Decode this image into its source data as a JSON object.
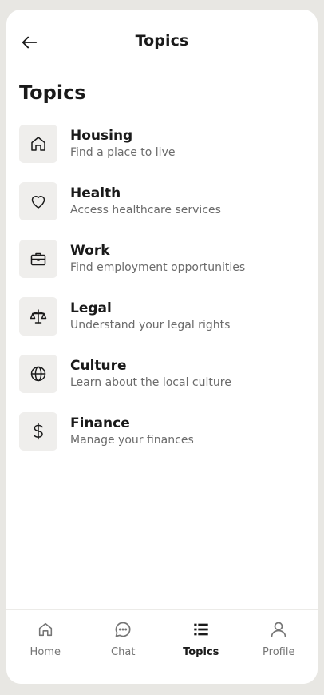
{
  "header": {
    "title": "Topics",
    "back_icon": "arrow-left-icon"
  },
  "page": {
    "title": "Topics"
  },
  "topics": [
    {
      "title": "Housing",
      "subtitle": "Find a place to live",
      "icon": "home-icon"
    },
    {
      "title": "Health",
      "subtitle": "Access healthcare services",
      "icon": "heart-icon"
    },
    {
      "title": "Work",
      "subtitle": "Find employment opportunities",
      "icon": "briefcase-icon"
    },
    {
      "title": "Legal",
      "subtitle": "Understand your legal rights",
      "icon": "scale-icon"
    },
    {
      "title": "Culture",
      "subtitle": "Learn about the local culture",
      "icon": "globe-icon"
    },
    {
      "title": "Finance",
      "subtitle": "Manage your finances",
      "icon": "dollar-icon"
    }
  ],
  "nav": {
    "active": "Topics",
    "items": [
      {
        "label": "Home",
        "icon": "home-icon"
      },
      {
        "label": "Chat",
        "icon": "chat-bubble-icon"
      },
      {
        "label": "Topics",
        "icon": "list-icon"
      },
      {
        "label": "Profile",
        "icon": "user-icon"
      }
    ]
  },
  "colors": {
    "background": "#e8e7e3",
    "card": "#ffffff",
    "icon_tile": "#efeeec",
    "text_primary": "#1a1a1a",
    "text_secondary": "#6b6b6b",
    "nav_inactive": "#757575"
  }
}
